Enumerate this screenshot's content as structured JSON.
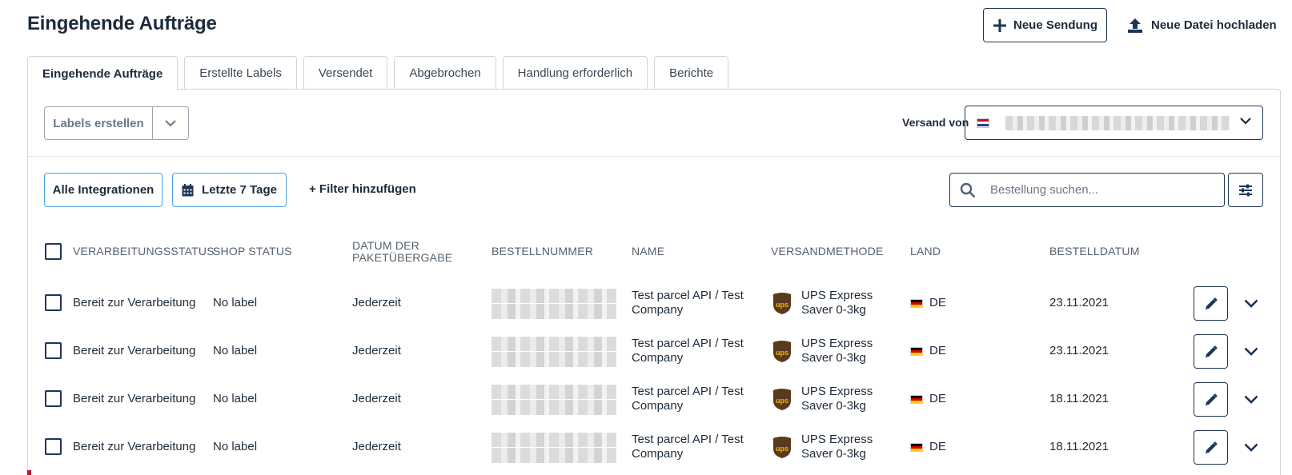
{
  "header": {
    "title": "Eingehende Aufträge",
    "new_shipment_label": "Neue Sendung",
    "upload_label": "Neue Datei hochladen"
  },
  "tabs": [
    {
      "label": "Eingehende Aufträge",
      "active": true
    },
    {
      "label": "Erstellte Labels",
      "active": false
    },
    {
      "label": "Versendet",
      "active": false
    },
    {
      "label": "Abgebrochen",
      "active": false
    },
    {
      "label": "Handlung erforderlich",
      "active": false
    },
    {
      "label": "Berichte",
      "active": false
    }
  ],
  "toolbar": {
    "create_labels": "Labels erstellen",
    "ship_from_label": "Versand von",
    "ship_from_flag": "netherlands-flag-icon"
  },
  "filters": {
    "integrations": "Alle Integrationen",
    "date_range": "Letzte 7 Tage",
    "add_filter": "+ Filter hinzufügen",
    "search_placeholder": "Bestellung suchen..."
  },
  "table": {
    "columns": [
      "VERARBEITUNGSSTATUS",
      "SHOP STATUS",
      "DATUM DER PAKETÜBERGABE",
      "BESTELLNUMMER",
      "NAME",
      "VERSANDMETHODE",
      "LAND",
      "BESTELLDATUM"
    ],
    "rows": [
      {
        "status": "Bereit zur Verarbeitung",
        "shop_status": "No label",
        "handover": "Jederzeit",
        "name": "Test parcel API / Test Company",
        "method": "UPS Express Saver 0-3kg",
        "country": "DE",
        "date": "23.11.2021"
      },
      {
        "status": "Bereit zur Verarbeitung",
        "shop_status": "No label",
        "handover": "Jederzeit",
        "name": "Test parcel API / Test Company",
        "method": "UPS Express Saver 0-3kg",
        "country": "DE",
        "date": "23.11.2021"
      },
      {
        "status": "Bereit zur Verarbeitung",
        "shop_status": "No label",
        "handover": "Jederzeit",
        "name": "Test parcel API / Test Company",
        "method": "UPS Express Saver 0-3kg",
        "country": "DE",
        "date": "18.11.2021"
      },
      {
        "status": "Bereit zur Verarbeitung",
        "shop_status": "No label",
        "handover": "Jederzeit",
        "name": "Test parcel API / Test Company",
        "method": "UPS Express Saver 0-3kg",
        "country": "DE",
        "date": "18.11.2021"
      }
    ]
  },
  "colors": {
    "primary": "#1d3557",
    "chip_border": "#4aa3df",
    "ups_brown": "#5a3a1e",
    "ups_gold": "#f5b400"
  }
}
